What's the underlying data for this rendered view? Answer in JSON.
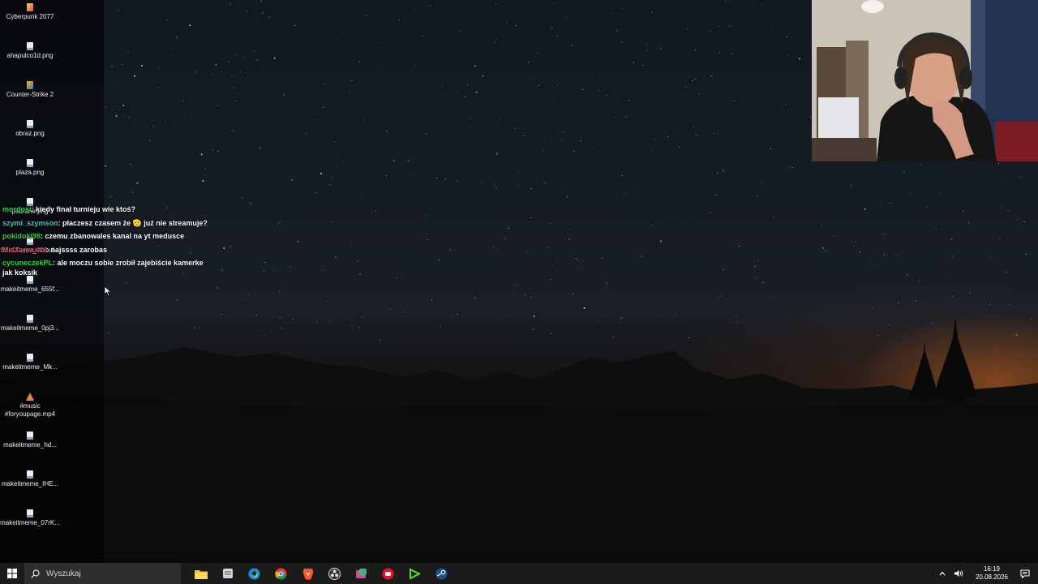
{
  "desktop": {
    "icons": [
      {
        "label": "Cyberpunk 2077",
        "icon": "cyberpunk-game-icon"
      },
      {
        "label": "ahapulco1d.png",
        "icon": "image-file-icon"
      },
      {
        "label": "Counter-Strike 2",
        "icon": "counter-strike-game-icon"
      },
      {
        "label": "obraz.png",
        "icon": "image-file-icon"
      },
      {
        "label": "plaza.png",
        "icon": "image-file-icon"
      },
      {
        "label": "pobrane.png",
        "icon": "image-file-icon"
      },
      {
        "label": "S8s1Twmo_400x4...",
        "icon": "image-file-icon"
      },
      {
        "label": "makeitmeme_655f...",
        "icon": "image-file-icon"
      },
      {
        "label": "makeitmeme_0pj3...",
        "icon": "image-file-icon"
      },
      {
        "label": "makeitmeme_Mk...",
        "icon": "image-file-icon"
      },
      {
        "label": "#music\n#foryoupage.mp4",
        "icon": "vlc-media-file-icon"
      },
      {
        "label": "makeitmeme_hd...",
        "icon": "image-file-icon"
      },
      {
        "label": "makeitmeme_IHE...",
        "icon": "image-file-icon"
      },
      {
        "label": "makeitmeme_07rK...",
        "icon": "image-file-icon"
      }
    ]
  },
  "chat": {
    "messages": [
      {
        "user": "mordosi",
        "user_color": "#2fd34a",
        "text": "kiedy finał turnieju wie ktoś?"
      },
      {
        "user": "szymi_szymson",
        "user_color": "#35c6c9",
        "text": "płaczesz czasem że 🫡 już nie streamuje?"
      },
      {
        "user": "pokidoki98",
        "user_color": "#32cd32",
        "text": "czemu zbanowales kanal na yt medusce"
      },
      {
        "user": "Misza_wuwe",
        "user_color": "#d94a6a",
        "text": "najssss zarobas"
      },
      {
        "user": "cycuneczekPL",
        "user_color": "#2fd34a",
        "text": "ale moczu sobie zrobił zajebiście kamerke jak koksik"
      }
    ]
  },
  "taskbar": {
    "search_placeholder": "Wyszukaj",
    "apps": [
      "file-explorer-icon",
      "notes-app-icon",
      "edge-browser-icon",
      "chrome-browser-icon",
      "brave-browser-icon",
      "obs-studio-icon",
      "snipping-tool-icon",
      "game-launcher-icon",
      "kick-app-icon",
      "steam-icon"
    ],
    "clock": {
      "time": "16:19",
      "date": "20.08.2026"
    }
  },
  "colors": {
    "taskbar_bg": "#1b1b1b",
    "search_bg": "#2d2d2d",
    "sunset_glow": "#c46828"
  }
}
